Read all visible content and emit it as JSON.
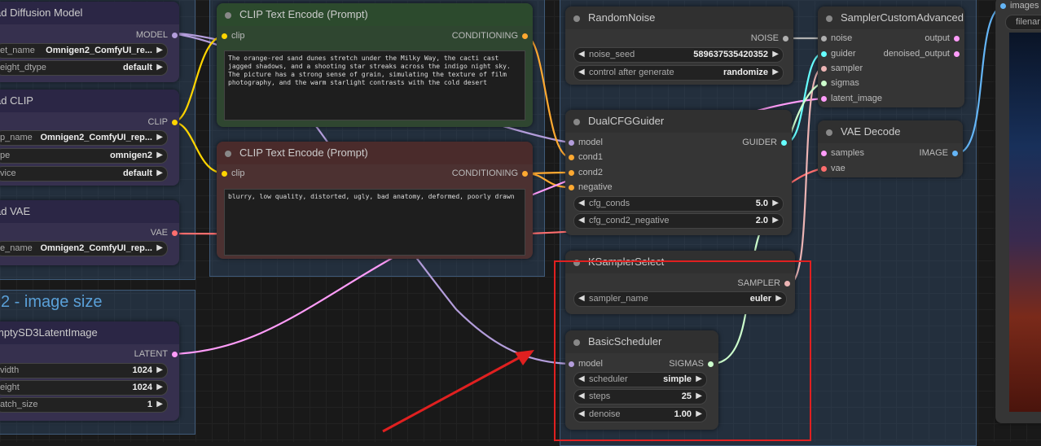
{
  "groups": {
    "image_size_title": "2 - image size"
  },
  "nodes": {
    "load_diffusion": {
      "title": "ad Diffusion Model",
      "output": "MODEL",
      "w1_label": "et_name",
      "w1_value": "Omnigen2_ComfyUI_re...",
      "w2_label": "eight_dtype",
      "w2_value": "default"
    },
    "load_clip": {
      "title": "ad CLIP",
      "output": "CLIP",
      "w1_label": "p_name",
      "w1_value": "Omnigen2_ComfyUI_rep...",
      "w2_label": "pe",
      "w2_value": "omnigen2",
      "w3_label": "vice",
      "w3_value": "default"
    },
    "load_vae": {
      "title": "ad VAE",
      "output": "VAE",
      "w1_label": "e_name",
      "w1_value": "Omnigen2_ComfyUI_rep..."
    },
    "empty_latent": {
      "title": "mptySD3LatentImage",
      "output": "LATENT",
      "w1_label": "vidth",
      "w1_value": "1024",
      "w2_label": "eight",
      "w2_value": "1024",
      "w3_label": "atch_size",
      "w3_value": "1"
    },
    "clip_pos": {
      "title": "CLIP Text Encode (Prompt)",
      "input": "clip",
      "output": "CONDITIONING",
      "text": "The orange-red sand dunes stretch under the Milky Way, the cacti cast jagged shadows, and a shooting star streaks across the indigo night sky. The picture has a strong sense of grain, simulating the texture of film photography, and the warm starlight contrasts with the cold desert"
    },
    "clip_neg": {
      "title": "CLIP Text Encode (Prompt)",
      "input": "clip",
      "output": "CONDITIONING",
      "text": "blurry, low quality, distorted, ugly, bad anatomy, deformed, poorly drawn"
    },
    "random_noise": {
      "title": "RandomNoise",
      "output": "NOISE",
      "w1_label": "noise_seed",
      "w1_value": "589637535420352",
      "w2_label": "control after generate",
      "w2_value": "randomize"
    },
    "dual_cfg": {
      "title": "DualCFGGuider",
      "in1": "model",
      "in2": "cond1",
      "in3": "cond2",
      "in4": "negative",
      "output": "GUIDER",
      "w1_label": "cfg_conds",
      "w1_value": "5.0",
      "w2_label": "cfg_cond2_negative",
      "w2_value": "2.0"
    },
    "ksampler_select": {
      "title": "KSamplerSelect",
      "output": "SAMPLER",
      "w1_label": "sampler_name",
      "w1_value": "euler"
    },
    "basic_scheduler": {
      "title": "BasicScheduler",
      "input": "model",
      "output": "SIGMAS",
      "w1_label": "scheduler",
      "w1_value": "simple",
      "w2_label": "steps",
      "w2_value": "25",
      "w3_label": "denoise",
      "w3_value": "1.00"
    },
    "sampler_custom": {
      "title": "SamplerCustomAdvanced",
      "in1": "noise",
      "in2": "guider",
      "in3": "sampler",
      "in4": "sigmas",
      "in5": "latent_image",
      "out1": "output",
      "out2": "denoised_output"
    },
    "vae_decode": {
      "title": "VAE Decode",
      "in1": "samples",
      "in2": "vae",
      "output": "IMAGE"
    },
    "save_image": {
      "input": "images",
      "w1_value": "filenar"
    }
  },
  "colors": {
    "model": "#b39ddb",
    "clip": "#ffd500",
    "conditioning": "#ffa931",
    "vae": "#ff6e6e",
    "latent": "#ff9cf9",
    "noise": "#b0b0b0",
    "guider": "#66ffff",
    "sampler": "#ecb4b4",
    "sigmas": "#cdffcd",
    "image": "#64b5f6",
    "highlight": "#e02020"
  }
}
